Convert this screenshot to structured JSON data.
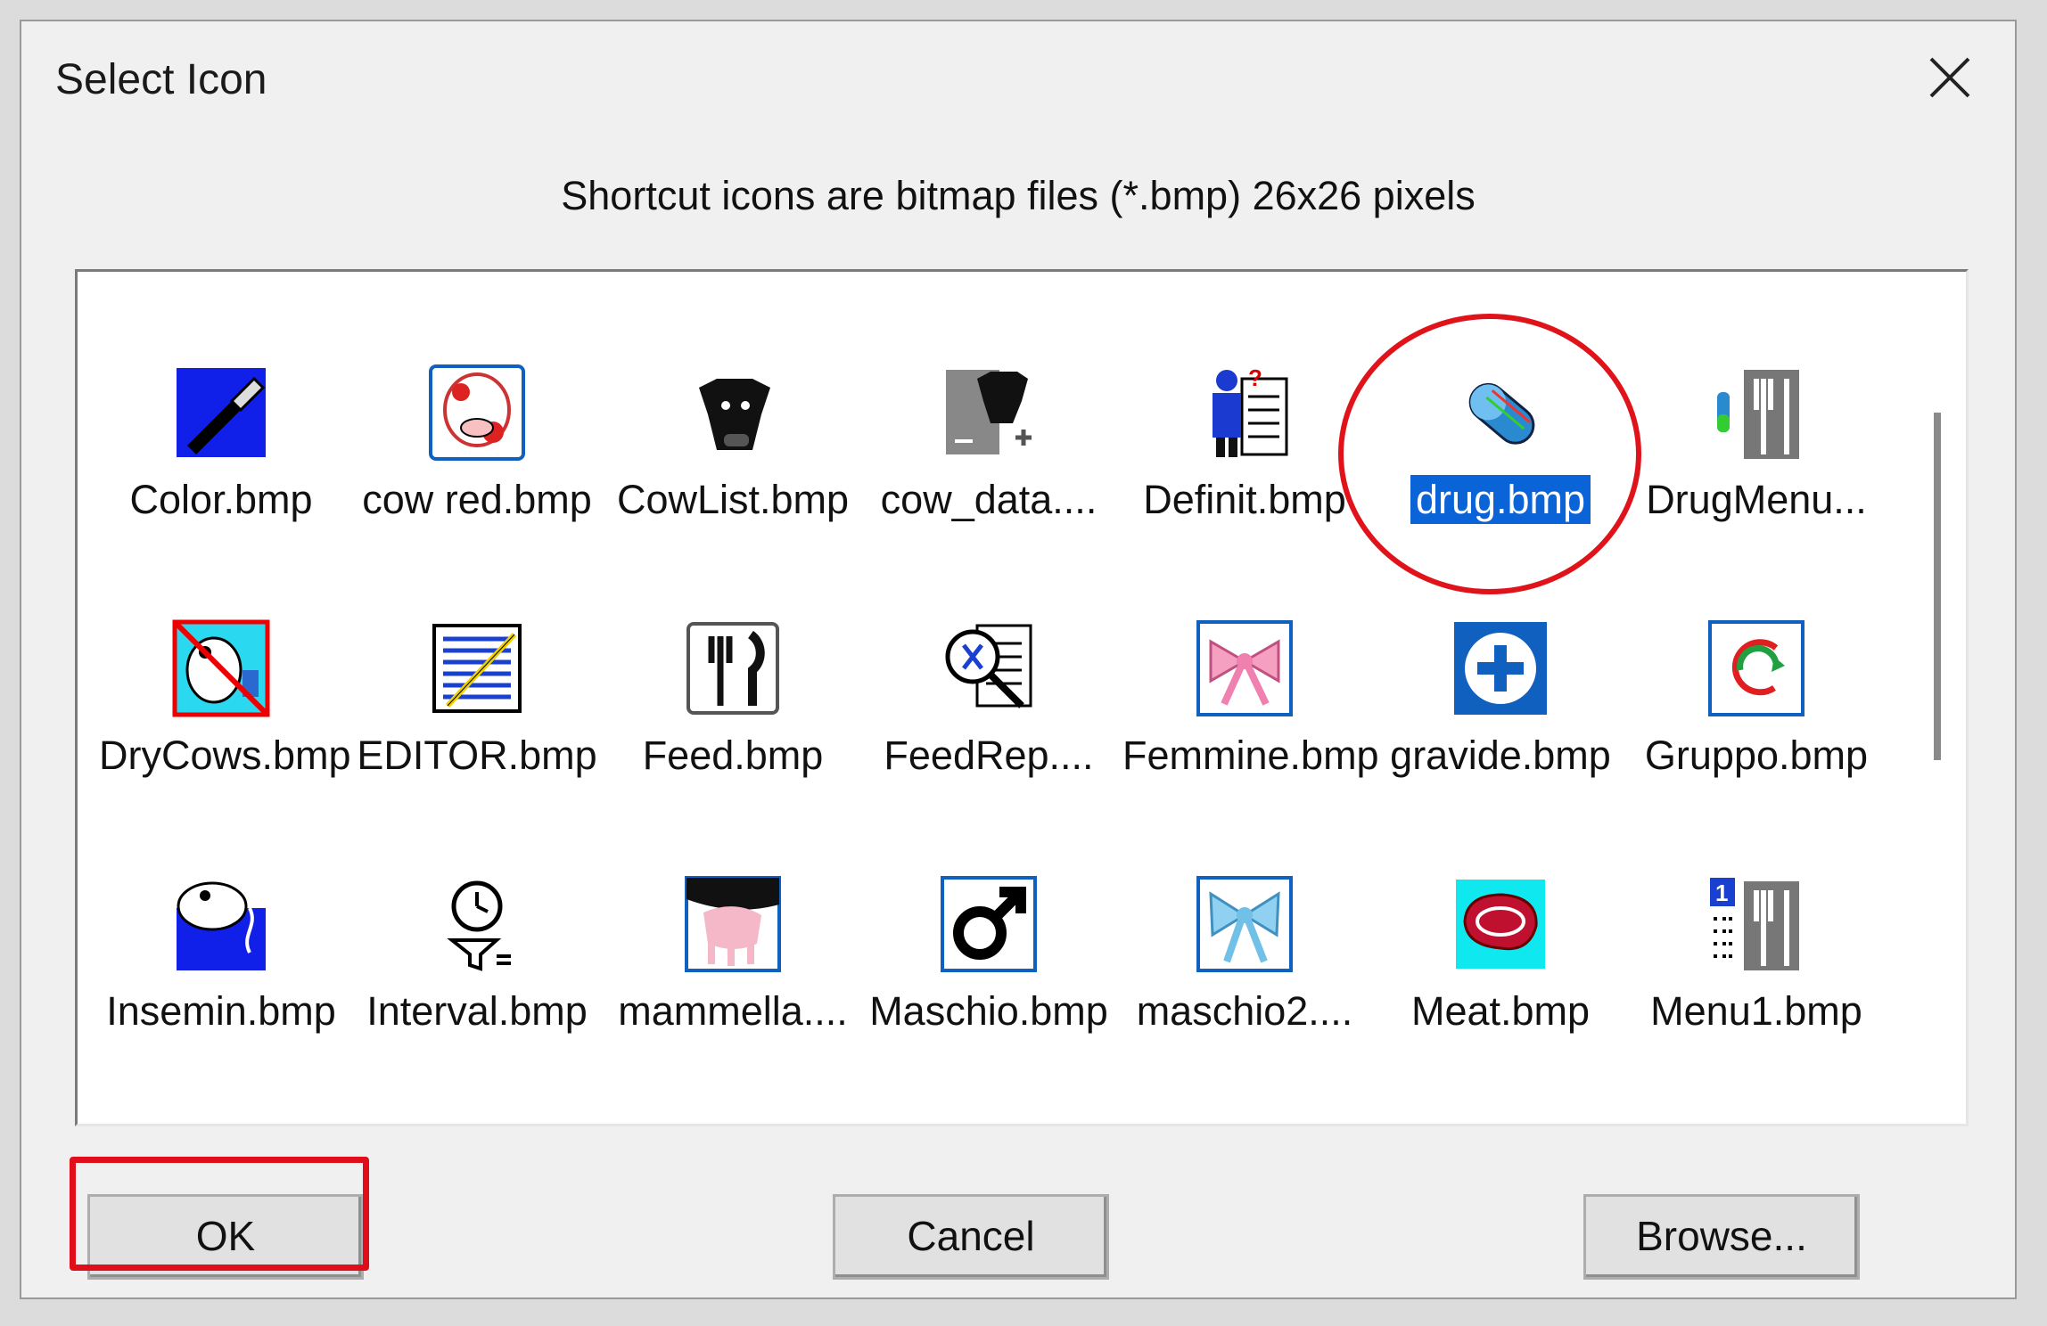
{
  "window": {
    "title": "Select Icon"
  },
  "hint": "Shortcut icons are bitmap files (*.bmp) 26x26 pixels",
  "icons": [
    {
      "label": "Color.bmp",
      "icon": "paintbrush-icon"
    },
    {
      "label": "cow red.bmp",
      "icon": "cow-face-red-icon"
    },
    {
      "label": "CowList.bmp",
      "icon": "cow-head-icon"
    },
    {
      "label": "cow_data....",
      "icon": "cow-data-icon"
    },
    {
      "label": "Definit.bmp",
      "icon": "person-question-icon"
    },
    {
      "label": "drug.bmp",
      "icon": "pill-icon",
      "selected": true
    },
    {
      "label": "DrugMenu...",
      "icon": "drug-menu-icon"
    },
    {
      "label": "DryCows.bmp",
      "icon": "dry-cows-icon"
    },
    {
      "label": "EDITOR.bmp",
      "icon": "editor-icon"
    },
    {
      "label": "Feed.bmp",
      "icon": "fork-knife-icon"
    },
    {
      "label": "FeedRep....",
      "icon": "feed-report-icon"
    },
    {
      "label": "Femmine.bmp",
      "icon": "pink-bow-icon"
    },
    {
      "label": "gravide.bmp",
      "icon": "plus-circle-icon"
    },
    {
      "label": "Gruppo.bmp",
      "icon": "group-arrows-icon"
    },
    {
      "label": "Insemin.bmp",
      "icon": "insemination-icon"
    },
    {
      "label": "Interval.bmp",
      "icon": "clock-filter-icon"
    },
    {
      "label": "mammella....",
      "icon": "udder-icon"
    },
    {
      "label": "Maschio.bmp",
      "icon": "male-symbol-icon"
    },
    {
      "label": "maschio2....",
      "icon": "blue-bow-icon"
    },
    {
      "label": "Meat.bmp",
      "icon": "steak-icon"
    },
    {
      "label": "Menu1.bmp",
      "icon": "menu-number-icon"
    }
  ],
  "buttons": {
    "ok": "OK",
    "cancel": "Cancel",
    "browse": "Browse..."
  },
  "colors": {
    "selection": "#0a64d8",
    "annotation": "#e00d1a"
  }
}
